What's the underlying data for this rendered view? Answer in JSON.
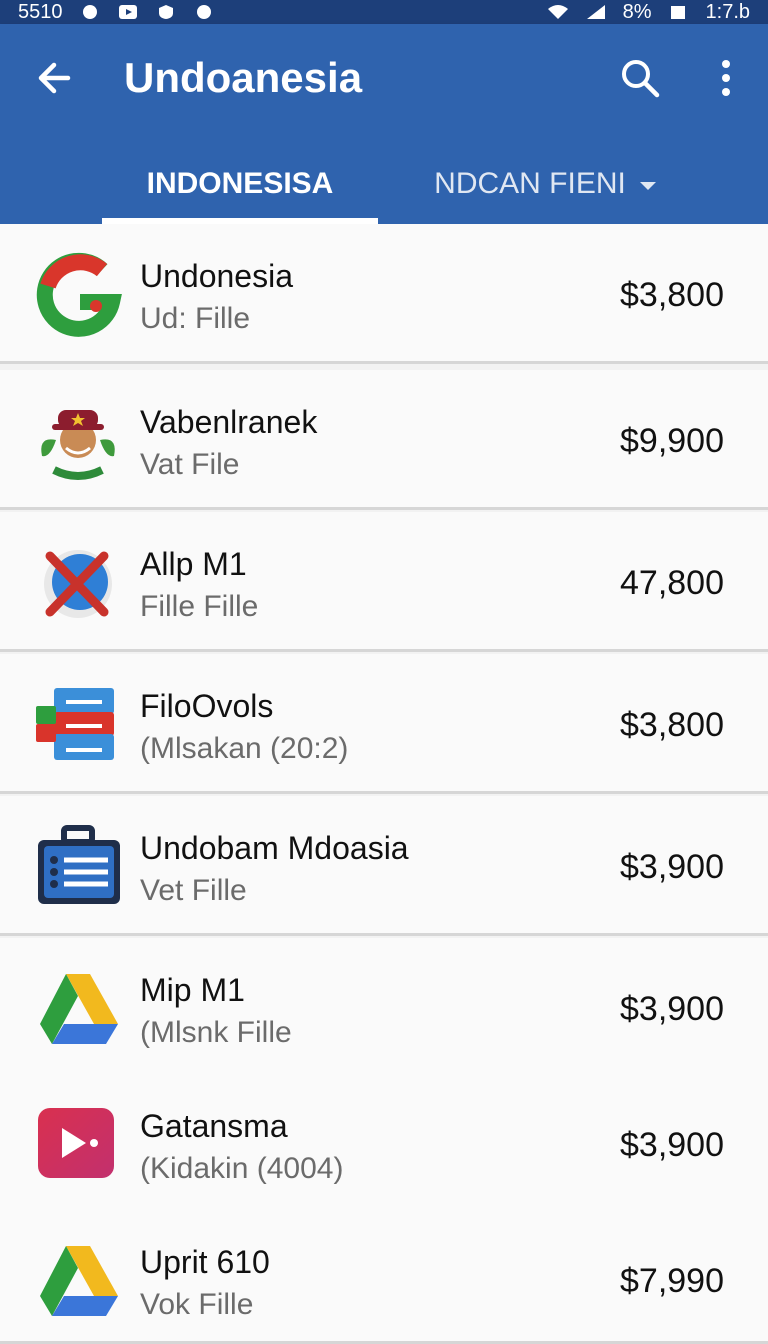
{
  "status_bar": {
    "time": "5510",
    "right_text": "8%",
    "right_time": "1:7.b"
  },
  "app_bar": {
    "title": "Undoanesia",
    "back_icon": "arrow-back-icon",
    "search_icon": "search-icon",
    "more_icon": "more-vert-icon",
    "color": "#2f63ae"
  },
  "tabs": [
    {
      "label": "INDONESISA",
      "selected": true
    },
    {
      "label": "NDCAN FIENI",
      "selected": false,
      "has_dropdown": true
    }
  ],
  "items": [
    {
      "title": "Undonesia",
      "subtitle": "Ud: Fille",
      "price": "$3,800",
      "icon": "red-green-g-icon"
    },
    {
      "title": "Vabenlranek",
      "subtitle": "Vat File",
      "price": "$9,900",
      "icon": "character-avatar-icon"
    },
    {
      "title": "Allp M1",
      "subtitle": "Fille Fille",
      "price": "47,800",
      "icon": "blue-circle-x-icon"
    },
    {
      "title": "FiloOvols",
      "subtitle": "(Mlsakan (20:2)",
      "price": "$3,800",
      "icon": "document-stack-icon"
    },
    {
      "title": "Undobam Mdoasia",
      "subtitle": "Vet Fille",
      "price": "$3,900",
      "icon": "briefcase-list-icon"
    },
    {
      "title": "Mip M1",
      "subtitle": "(Mlsnk Fille",
      "price": "$3,900",
      "icon": "drive-triangle-icon"
    },
    {
      "title": "Gatansma",
      "subtitle": "(Kidakin (4004)",
      "price": "$3,900",
      "icon": "play-button-icon"
    },
    {
      "title": "Uprit 610",
      "subtitle": "Vok Fille",
      "price": "$7,990",
      "icon": "drive-triangle-icon"
    }
  ]
}
